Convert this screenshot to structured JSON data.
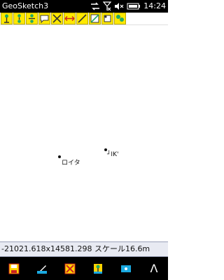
{
  "status_bar": {
    "app_title": "GeoSketch3",
    "time": "14:24",
    "icons": [
      "sync-icon",
      "no-signal-icon",
      "mute-icon",
      "battery-icon"
    ]
  },
  "toolbar": {
    "buttons": [
      "pin-tool-icon",
      "pin-pair-tool-icon",
      "pin-multi-tool-icon",
      "note-icon",
      "erase-cross-icon",
      "move-arrows-icon",
      "line-tool-icon",
      "select-tool-icon",
      "label-tool-icon",
      "layers-tool-icon"
    ]
  },
  "map": {
    "points": [
      {
        "label": "ロイタ"
      },
      {
        "label": "┘IK'"
      }
    ]
  },
  "coordinates": {
    "text": "-21021.618x14581.298 スケール16.6m"
  },
  "bottom_bar": {
    "buttons": [
      "save-icon",
      "pen-icon",
      "delete-icon",
      "add-point-icon",
      "point-mode-icon"
    ],
    "caret": "Λ"
  }
}
